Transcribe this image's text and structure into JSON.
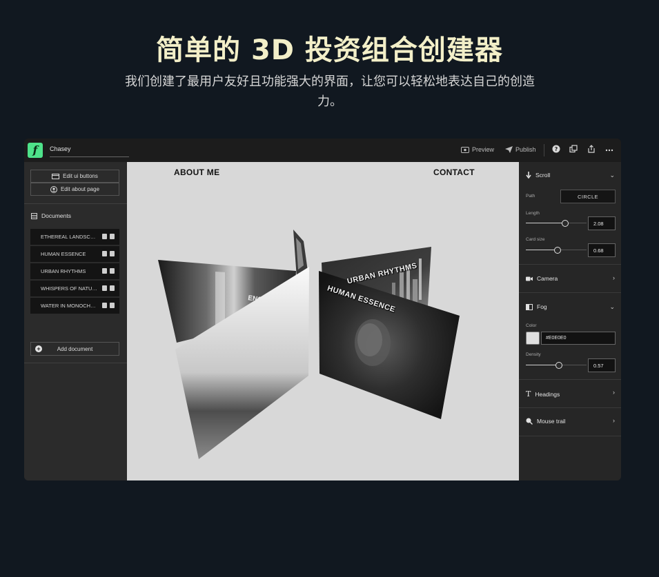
{
  "hero": {
    "title": "简单的 3D 投资组合创建器",
    "subtitle": "我们创建了最用户友好且功能强大的界面，让您可以轻松地表达自己的创造力。"
  },
  "topbar": {
    "logo_glyph": "f",
    "project_name": "Chasey",
    "preview_label": "Preview",
    "publish_label": "Publish",
    "icons": [
      "eye-icon",
      "send-icon",
      "help-icon",
      "duplicate-icon",
      "share-icon",
      "more-icon"
    ]
  },
  "sidebar_left": {
    "edit_ui_buttons": "Edit ui buttons",
    "edit_about_page": "Edit about page",
    "documents_label": "Documents",
    "documents": [
      {
        "name": "ETHEREAL LANDSCAPES"
      },
      {
        "name": "HUMAN ESSENCE"
      },
      {
        "name": "URBAN RHYTHMS"
      },
      {
        "name": "WHISPERS OF NATURE"
      },
      {
        "name": "WATER IN MONOCHROME"
      }
    ],
    "add_document": "Add document"
  },
  "canvas": {
    "nav_about": "ABOUT ME",
    "nav_contact": "CONTACT",
    "background": "#D8D8D8",
    "cards": [
      {
        "label": "URBAN RHYTHMS"
      },
      {
        "label": "HUMAN ESSENCE"
      }
    ]
  },
  "sidebar_right": {
    "scroll": {
      "title": "Scroll",
      "path_label": "Path",
      "path_value": "CIRCLE",
      "length_label": "Length",
      "length_value": "2.08",
      "length_level": 0.65,
      "card_size_label": "Card size",
      "card_size_value": "0.68",
      "card_size_level": 0.52
    },
    "camera": {
      "title": "Camera"
    },
    "fog": {
      "title": "Fog",
      "color_label": "Color",
      "color_value": "#E0E0E0",
      "density_label": "Density",
      "density_value": "0.57",
      "density_level": 0.55
    },
    "headings": {
      "title": "Headings"
    },
    "mouse_trail": {
      "title": "Mouse trail"
    }
  },
  "colors": {
    "page_bg": "#111820",
    "hero_title": "#F3EFC8",
    "logo_green": "#4EE28A"
  }
}
